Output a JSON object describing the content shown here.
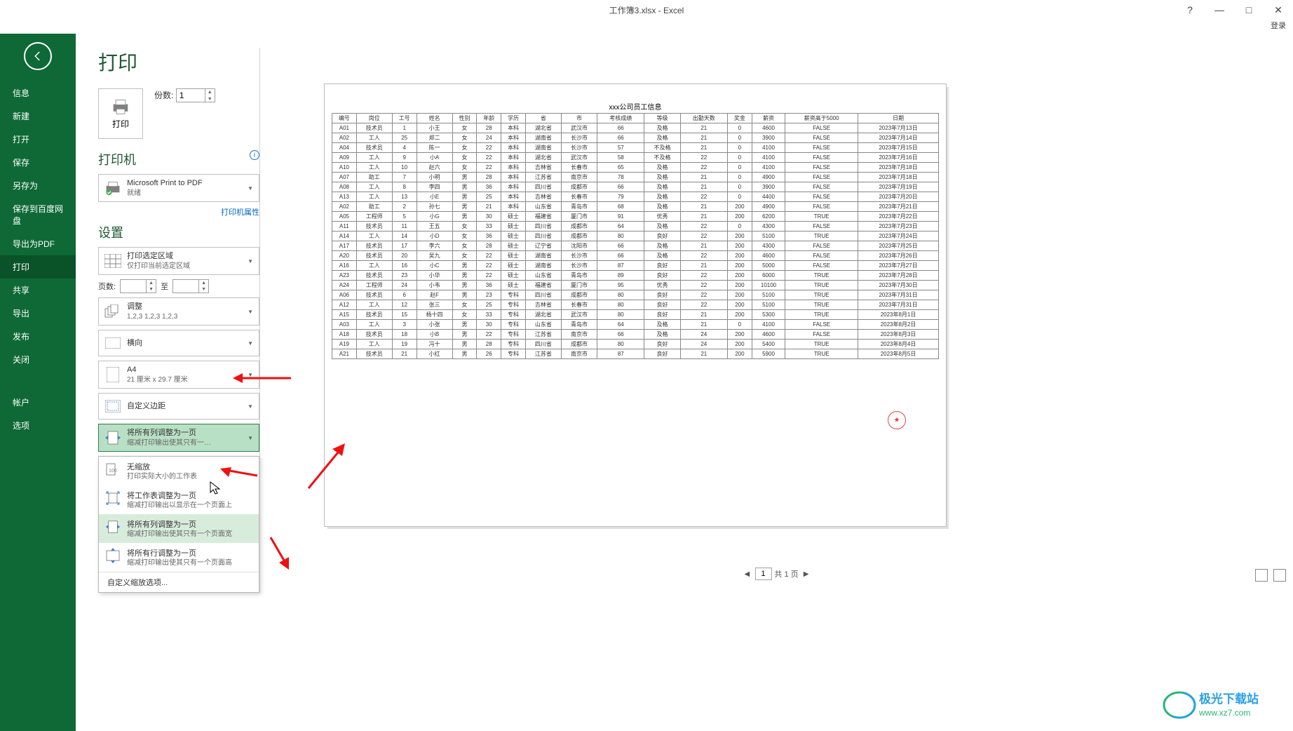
{
  "titlebar": {
    "title": "工作簿3.xlsx - Excel",
    "login": "登录",
    "help": "?",
    "min": "—",
    "max": "□",
    "close": "✕"
  },
  "sidebar": {
    "items": [
      "信息",
      "新建",
      "打开",
      "保存",
      "另存为",
      "保存到百度网盘",
      "导出为PDF",
      "打印",
      "共享",
      "导出",
      "发布",
      "关闭"
    ],
    "bottom": [
      "帐户",
      "选项"
    ],
    "active_index": 7
  },
  "page": {
    "title": "打印"
  },
  "print_btn": {
    "label": "打印"
  },
  "copies": {
    "label": "份数:",
    "value": "1"
  },
  "printer_section": {
    "title": "打印机",
    "name": "Microsoft Print to PDF",
    "status": "就绪",
    "properties": "打印机属性"
  },
  "settings": {
    "title": "设置",
    "area": {
      "title": "打印选定区域",
      "sub": "仅打印当前选定区域"
    },
    "page_range": {
      "label": "页数:",
      "to": "至"
    },
    "collate": {
      "title": "调整",
      "sub": "1,2,3   1,2,3   1,2,3"
    },
    "orientation": {
      "title": "横向"
    },
    "paper": {
      "title": "A4",
      "sub": "21 厘米 x 29.7 厘米"
    },
    "margins": {
      "title": "自定义边距"
    },
    "scaling_selected": {
      "title": "将所有列调整为一页",
      "sub": "缩减打印输出使其只有一…"
    },
    "scaling_options": [
      {
        "title": "无缩放",
        "sub": "打印实际大小的工作表"
      },
      {
        "title": "将工作表调整为一页",
        "sub": "缩减打印输出以显示在一个页面上"
      },
      {
        "title": "将所有列调整为一页",
        "sub": "缩减打印输出使其只有一个页面宽"
      },
      {
        "title": "将所有行调整为一页",
        "sub": "缩减打印输出使其只有一个页面高"
      }
    ],
    "custom_scaling": "自定义缩放选项..."
  },
  "pager": {
    "current": "1",
    "total_text": "共 1 页"
  },
  "chart_data": {
    "type": "table",
    "title": "xxx公司员工信息",
    "headers": [
      "编号",
      "岗位",
      "工号",
      "姓名",
      "性别",
      "年龄",
      "学历",
      "省",
      "市",
      "考核成绩",
      "等级",
      "出勤天数",
      "奖金",
      "薪资",
      "薪资高于5000",
      "日期"
    ],
    "rows": [
      [
        "A01",
        "技术员",
        "1",
        "小王",
        "女",
        "28",
        "本科",
        "湖北省",
        "武汉市",
        "66",
        "及格",
        "21",
        "0",
        "4600",
        "FALSE",
        "2023年7月13日"
      ],
      [
        "A02",
        "工人",
        "25",
        "郑二",
        "女",
        "24",
        "本科",
        "湖南省",
        "长沙市",
        "66",
        "及格",
        "21",
        "0",
        "3900",
        "FALSE",
        "2023年7月14日"
      ],
      [
        "A04",
        "技术员",
        "4",
        "陈一",
        "女",
        "22",
        "本科",
        "湖南省",
        "长沙市",
        "57",
        "不及格",
        "21",
        "0",
        "4100",
        "FALSE",
        "2023年7月15日"
      ],
      [
        "A09",
        "工人",
        "9",
        "小A",
        "女",
        "22",
        "本科",
        "湖北省",
        "武汉市",
        "58",
        "不及格",
        "22",
        "0",
        "4100",
        "FALSE",
        "2023年7月16日"
      ],
      [
        "A10",
        "工人",
        "10",
        "赵六",
        "女",
        "22",
        "本科",
        "吉林省",
        "长春市",
        "65",
        "及格",
        "22",
        "0",
        "4100",
        "FALSE",
        "2023年7月18日"
      ],
      [
        "A07",
        "助工",
        "7",
        "小明",
        "男",
        "28",
        "本科",
        "江苏省",
        "南京市",
        "78",
        "及格",
        "21",
        "0",
        "4900",
        "FALSE",
        "2023年7月18日"
      ],
      [
        "A08",
        "工人",
        "8",
        "李四",
        "男",
        "36",
        "本科",
        "四川省",
        "成都市",
        "66",
        "及格",
        "21",
        "0",
        "3900",
        "FALSE",
        "2023年7月19日"
      ],
      [
        "A13",
        "工人",
        "13",
        "小E",
        "男",
        "25",
        "本科",
        "吉林省",
        "长春市",
        "79",
        "及格",
        "22",
        "0",
        "4400",
        "FALSE",
        "2023年7月20日"
      ],
      [
        "A02",
        "助工",
        "2",
        "孙七",
        "男",
        "21",
        "本科",
        "山东省",
        "青岛市",
        "68",
        "及格",
        "21",
        "200",
        "4900",
        "FALSE",
        "2023年7月21日"
      ],
      [
        "A05",
        "工程师",
        "5",
        "小G",
        "男",
        "30",
        "硕士",
        "福建省",
        "厦门市",
        "91",
        "优秀",
        "21",
        "200",
        "6200",
        "TRUE",
        "2023年7月22日"
      ],
      [
        "A11",
        "技术员",
        "11",
        "王五",
        "女",
        "33",
        "硕士",
        "四川省",
        "成都市",
        "64",
        "及格",
        "22",
        "0",
        "4300",
        "FALSE",
        "2023年7月23日"
      ],
      [
        "A14",
        "工人",
        "14",
        "小D",
        "女",
        "36",
        "硕士",
        "四川省",
        "成都市",
        "80",
        "良好",
        "22",
        "200",
        "5100",
        "TRUE",
        "2023年7月24日"
      ],
      [
        "A17",
        "技术员",
        "17",
        "李六",
        "女",
        "28",
        "硕士",
        "辽宁省",
        "沈阳市",
        "66",
        "及格",
        "21",
        "200",
        "4300",
        "FALSE",
        "2023年7月25日"
      ],
      [
        "A20",
        "技术员",
        "20",
        "吴九",
        "女",
        "22",
        "硕士",
        "湖南省",
        "长沙市",
        "66",
        "及格",
        "22",
        "200",
        "4600",
        "FALSE",
        "2023年7月26日"
      ],
      [
        "A16",
        "工人",
        "16",
        "小C",
        "男",
        "22",
        "硕士",
        "湖南省",
        "长沙市",
        "87",
        "良好",
        "21",
        "200",
        "5000",
        "FALSE",
        "2023年7月27日"
      ],
      [
        "A23",
        "技术员",
        "23",
        "小华",
        "男",
        "22",
        "硕士",
        "山东省",
        "青岛市",
        "89",
        "良好",
        "22",
        "200",
        "6000",
        "TRUE",
        "2023年7月28日"
      ],
      [
        "A24",
        "工程师",
        "24",
        "小韦",
        "男",
        "36",
        "硕士",
        "福建省",
        "厦门市",
        "95",
        "优秀",
        "22",
        "200",
        "10100",
        "TRUE",
        "2023年7月30日"
      ],
      [
        "A06",
        "技术员",
        "6",
        "赵F",
        "男",
        "23",
        "专科",
        "四川省",
        "成都市",
        "80",
        "良好",
        "22",
        "200",
        "5100",
        "TRUE",
        "2023年7月31日"
      ],
      [
        "A12",
        "工人",
        "12",
        "张三",
        "女",
        "25",
        "专科",
        "吉林省",
        "长春市",
        "80",
        "良好",
        "22",
        "200",
        "5100",
        "TRUE",
        "2023年7月31日"
      ],
      [
        "A15",
        "技术员",
        "15",
        "杨十四",
        "女",
        "33",
        "专科",
        "湖北省",
        "武汉市",
        "80",
        "良好",
        "21",
        "200",
        "5300",
        "TRUE",
        "2023年8月1日"
      ],
      [
        "A03",
        "工人",
        "3",
        "小张",
        "男",
        "30",
        "专科",
        "山东省",
        "青岛市",
        "64",
        "及格",
        "21",
        "0",
        "4100",
        "FALSE",
        "2023年8月2日"
      ],
      [
        "A18",
        "技术员",
        "18",
        "小B",
        "男",
        "22",
        "专科",
        "江苏省",
        "南京市",
        "66",
        "及格",
        "24",
        "200",
        "4600",
        "FALSE",
        "2023年8月3日"
      ],
      [
        "A19",
        "工人",
        "19",
        "冯十",
        "男",
        "28",
        "专科",
        "四川省",
        "成都市",
        "80",
        "良好",
        "24",
        "200",
        "5400",
        "TRUE",
        "2023年8月4日"
      ],
      [
        "A21",
        "技术员",
        "21",
        "小红",
        "男",
        "26",
        "专科",
        "江苏省",
        "南京市",
        "87",
        "良好",
        "21",
        "200",
        "5900",
        "TRUE",
        "2023年8月5日"
      ]
    ]
  },
  "watermark": {
    "line1": "极光下载站",
    "line2": "www.xz7.com"
  }
}
